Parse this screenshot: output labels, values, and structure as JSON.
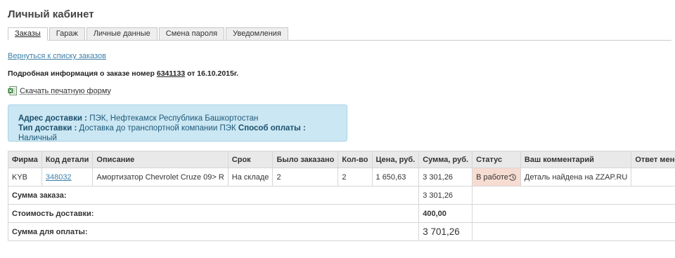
{
  "page": {
    "title": "Личный кабинет"
  },
  "tabs": [
    "Заказы",
    "Гараж",
    "Личные данные",
    "Смена пароля",
    "Уведомления"
  ],
  "back_link": "Вернуться к списку заказов",
  "order": {
    "info_prefix": "Подробная информация о заказе номер",
    "number": "6341133",
    "date_text": "от 16.10.2015г."
  },
  "print": {
    "label": "Скачать печатную форму",
    "icon": "excel-file-icon"
  },
  "delivery": {
    "address_label": "Адрес доставки :",
    "address_value": "ПЭК, Нефтекамск Республика Башкортостан",
    "type_label": "Тип доставки :",
    "type_value": "Доставка до транспортной компании ПЭК",
    "payment_label": "Способ оплаты :",
    "payment_value": "Наличный"
  },
  "table": {
    "headers": [
      "Фирма",
      "Код детали",
      "Описание",
      "Срок",
      "Было заказано",
      "Кол-во",
      "Цена, руб.",
      "Сумма, руб.",
      "Статус",
      "Ваш комментарий",
      "Ответ менеджера"
    ],
    "rows": [
      {
        "brand": "KYB",
        "code": "348032",
        "description": "Амортизатор Chevrolet Cruze 09> R",
        "term": "На складе",
        "ordered": "2",
        "qty": "2",
        "price": "1 650,63",
        "sum": "3 301,26",
        "status": "В работе",
        "comment": "Деталь найдена на ZZAP.RU",
        "manager_reply": ""
      }
    ],
    "summary": {
      "order_sum_label": "Сумма заказа:",
      "order_sum_value": "3 301,26",
      "delivery_label": "Стоимость доставки:",
      "delivery_value": "400,00",
      "total_label": "Сумма для оплаты:",
      "total_value": "3 701,26"
    }
  },
  "colors": {
    "accent_link": "#3c7fa8",
    "status_bg": "#f7dcd2",
    "info_box_bg": "#cbe7f3"
  }
}
